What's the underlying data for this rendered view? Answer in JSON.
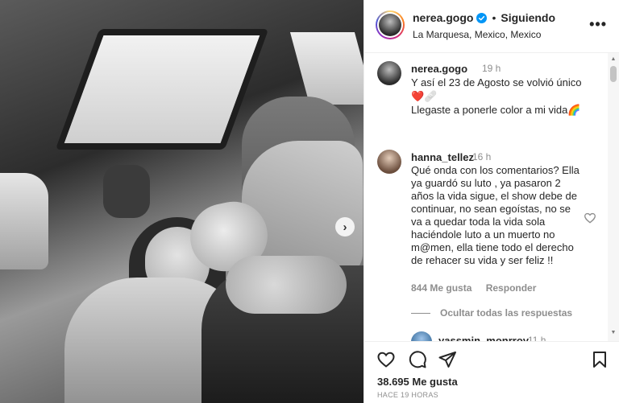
{
  "post": {
    "username": "nerea.gogo",
    "following_label": "Siguiendo",
    "separator": "•",
    "location": "La Marquesa, Mexico, Mexico",
    "more_label": "•••",
    "next_label": "›"
  },
  "caption": {
    "username": "nerea.gogo",
    "time": "19 h",
    "line1": "Y así el 23 de Agosto se volvió único",
    "line2": "❤️🩹",
    "line3": "Llegaste a ponerle color a mi vida🌈"
  },
  "comment": {
    "username": "hanna_tellez",
    "time": "16 h",
    "text": "Qué onda con los comentarios? Ella ya guardó su luto , ya pasaron 2 años la vida sigue, el show debe de continuar, no sean egoístas, no se va a quedar toda la vida sola haciéndole luto a un muerto no m@men, ella tiene todo el derecho de rehacer su vida y ser feliz !!",
    "likes": "844 Me gusta",
    "reply_label": "Responder",
    "hide_replies": "Ocultar todas las respuestas"
  },
  "reply": {
    "username": "yassmin_monrroy",
    "time": "11 h"
  },
  "footer": {
    "likes": "38.695 Me gusta",
    "time_ago": "HACE 19 HORAS"
  },
  "icons": {
    "verified": "verified-badge-icon",
    "like": "heart-icon",
    "comment": "comment-bubble-icon",
    "share": "paper-plane-icon",
    "save": "bookmark-icon",
    "more": "more-options-icon",
    "next": "chevron-right-icon"
  },
  "colors": {
    "verified": "#0095f6",
    "text": "#262626",
    "muted": "#8e8e8e",
    "divider": "#efefef"
  }
}
